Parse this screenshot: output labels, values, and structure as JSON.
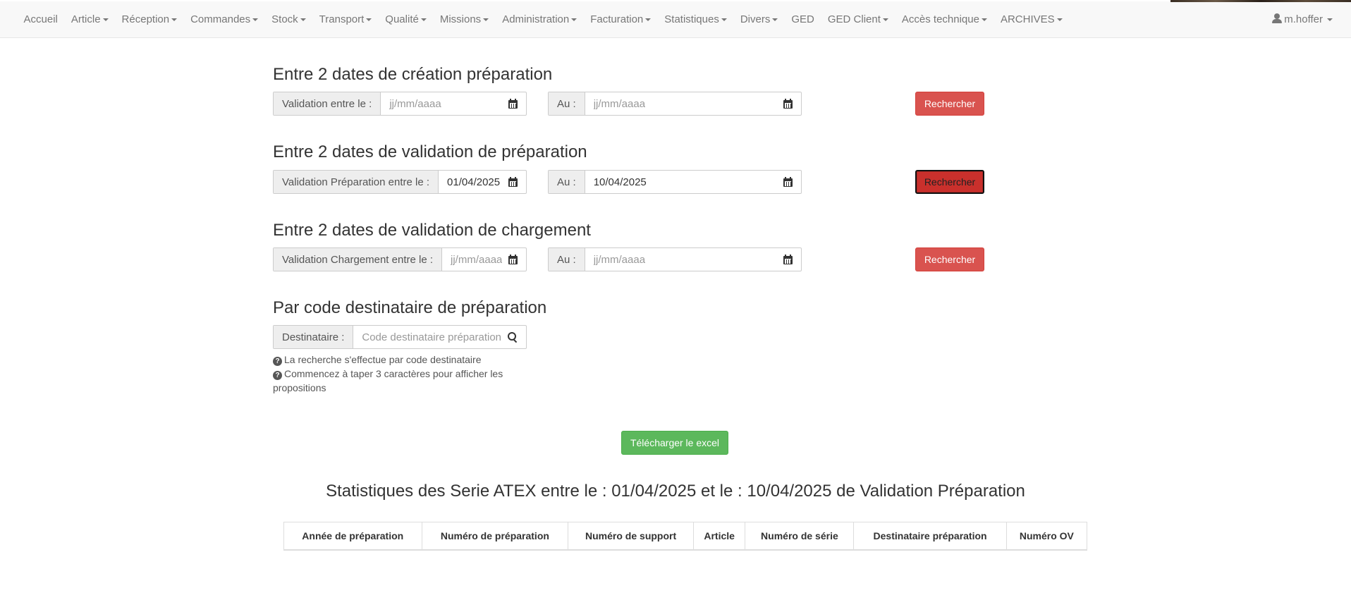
{
  "navbar": {
    "items": [
      {
        "label": "Accueil",
        "dropdown": false
      },
      {
        "label": "Article",
        "dropdown": true
      },
      {
        "label": "Réception",
        "dropdown": true
      },
      {
        "label": "Commandes",
        "dropdown": true
      },
      {
        "label": "Stock",
        "dropdown": true
      },
      {
        "label": "Transport",
        "dropdown": true
      },
      {
        "label": "Qualité",
        "dropdown": true
      },
      {
        "label": "Missions",
        "dropdown": true
      },
      {
        "label": "Administration",
        "dropdown": true
      },
      {
        "label": "Facturation",
        "dropdown": true
      },
      {
        "label": "Statistiques",
        "dropdown": true
      },
      {
        "label": "Divers",
        "dropdown": true
      },
      {
        "label": "GED",
        "dropdown": false
      },
      {
        "label": "GED Client",
        "dropdown": true
      },
      {
        "label": "Accès technique",
        "dropdown": true
      },
      {
        "label": "ARCHIVES",
        "dropdown": true
      }
    ],
    "user": "m.hoffer"
  },
  "sections": {
    "creation": {
      "title": "Entre 2 dates de création préparation",
      "from_label": "Validation entre le :",
      "from_value": "",
      "from_placeholder": "jj/mm/aaaa",
      "to_label": "Au :",
      "to_value": "",
      "to_placeholder": "jj/mm/aaaa",
      "button": "Rechercher"
    },
    "validation": {
      "title": "Entre 2 dates de validation de préparation",
      "from_label": "Validation Préparation entre le :",
      "from_value": "01/04/2025",
      "from_placeholder": "jj/mm/aaaa",
      "to_label": "Au :",
      "to_value": "10/04/2025",
      "to_placeholder": "jj/mm/aaaa",
      "button": "Rechercher"
    },
    "chargement": {
      "title": "Entre 2 dates de validation de chargement",
      "from_label": "Validation Chargement entre le :",
      "from_value": "",
      "from_placeholder": "jj/mm/aaaa",
      "to_label": "Au :",
      "to_value": "",
      "to_placeholder": "jj/mm/aaaa",
      "button": "Rechercher"
    },
    "destinataire": {
      "title": "Par code destinataire de préparation",
      "label": "Destinataire :",
      "value": "",
      "placeholder": "Code destinataire préparation",
      "help": [
        "La recherche s'effectue par code destinataire",
        "Commencez à taper 3 caractères pour afficher les propositions"
      ]
    }
  },
  "export_button": "Télécharger le excel",
  "stats": {
    "title": "Statistiques des Serie ATEX entre le : 01/04/2025 et le : 10/04/2025 de Validation Préparation",
    "columns": [
      "Année de préparation",
      "Numéro de préparation",
      "Numéro de support",
      "Article",
      "Numéro de série",
      "Destinataire préparation",
      "Numéro OV"
    ]
  },
  "colors": {
    "danger": "#d9534f",
    "danger_active": "#c9302c",
    "success": "#5cb85c",
    "navbar_bg": "#f8f8f8",
    "nav_text": "#777777"
  }
}
